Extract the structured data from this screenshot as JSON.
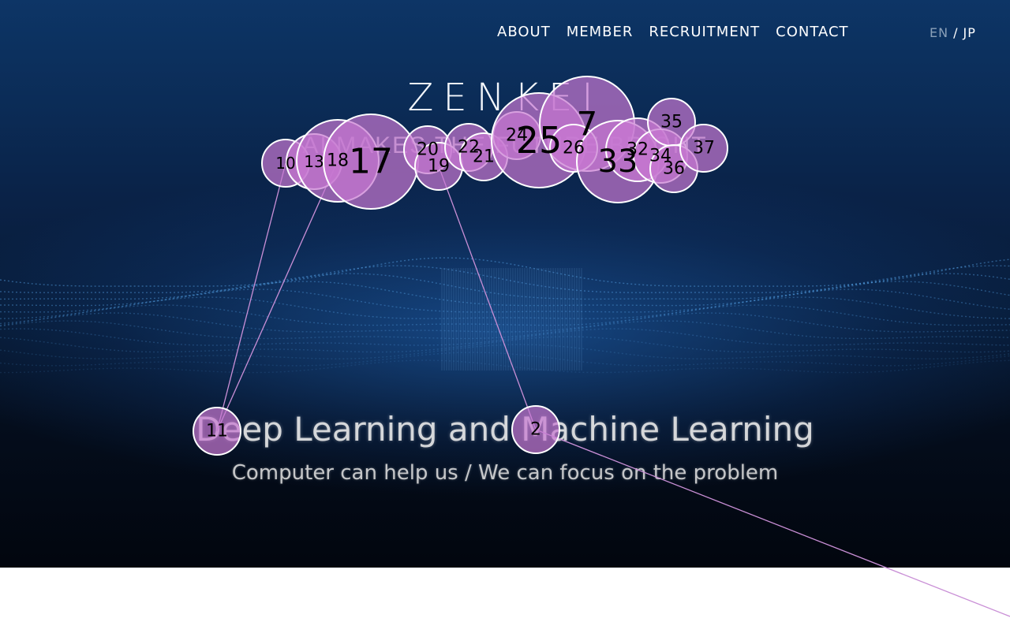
{
  "nav": {
    "items": [
      "ABOUT",
      "MEMBER",
      "RECRUITMENT",
      "CONTACT"
    ],
    "lang_en": "EN",
    "lang_sep": "/",
    "lang_jp": "JP"
  },
  "hero": {
    "logo": "ZENKEI",
    "tagline": "AI MAKES THE FUTURE BRIGHT",
    "headline": "Deep Learning and Machine Learning",
    "subline": "Computer can help us / We can focus on the problem"
  },
  "gaze_overlay": {
    "fixations": [
      {
        "label": "10"
      },
      {
        "label": "13"
      },
      {
        "label": "18"
      },
      {
        "label": "17"
      },
      {
        "label": "20"
      },
      {
        "label": "19"
      },
      {
        "label": "22"
      },
      {
        "label": "21"
      },
      {
        "label": "24"
      },
      {
        "label": "25"
      },
      {
        "label": "7"
      },
      {
        "label": "26"
      },
      {
        "label": "33"
      },
      {
        "label": "32"
      },
      {
        "label": "34"
      },
      {
        "label": "35"
      },
      {
        "label": "36"
      },
      {
        "label": "37"
      },
      {
        "label": "11"
      },
      {
        "label": "2"
      }
    ],
    "colors": {
      "fill": "#c878d2",
      "stroke": "#ffffff",
      "line": "#c98fd6"
    }
  }
}
